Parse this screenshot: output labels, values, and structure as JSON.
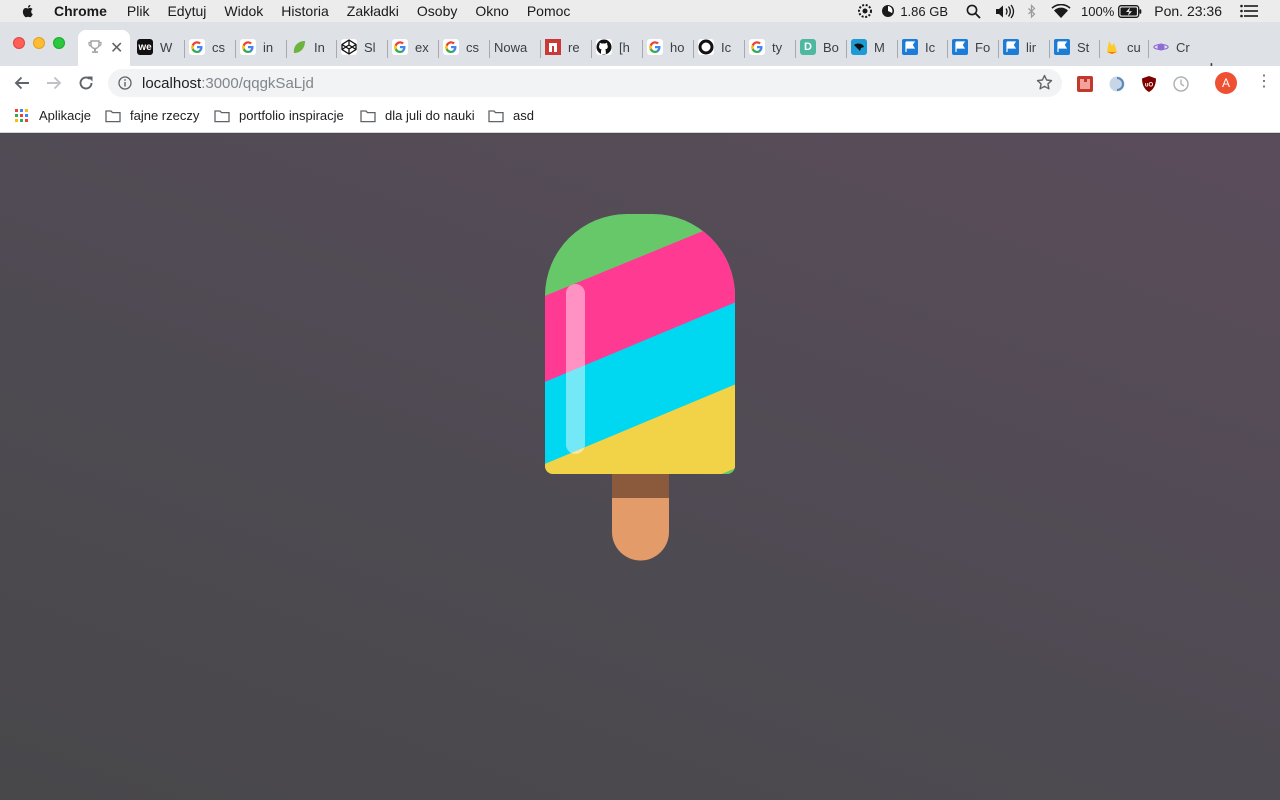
{
  "menubar": {
    "app_name": "Chrome",
    "items": [
      "Plik",
      "Edytuj",
      "Widok",
      "Historia",
      "Zakładki",
      "Osoby",
      "Okno",
      "Pomoc"
    ],
    "ram": "1.86 GB",
    "battery": "100%",
    "clock": "Pon. 23:36"
  },
  "tabs": [
    {
      "title": "W",
      "favicon": "we-icon"
    },
    {
      "title": "cs",
      "favicon": "google-icon"
    },
    {
      "title": "in",
      "favicon": "google-icon"
    },
    {
      "title": "In",
      "favicon": "leaf-icon"
    },
    {
      "title": "Sl",
      "favicon": "codepen-icon"
    },
    {
      "title": "ex",
      "favicon": "google-icon"
    },
    {
      "title": "cs",
      "favicon": "google-icon"
    },
    {
      "title": "Nowa",
      "favicon": ""
    },
    {
      "title": "re",
      "favicon": "npm-icon"
    },
    {
      "title": "[h",
      "favicon": "github-icon"
    },
    {
      "title": "ho",
      "favicon": "google-icon"
    },
    {
      "title": "Ic",
      "favicon": "ring-icon"
    },
    {
      "title": "ty",
      "favicon": "google-icon"
    },
    {
      "title": "Bo",
      "favicon": "d-icon"
    },
    {
      "title": "M",
      "favicon": "bird-icon"
    },
    {
      "title": "Ic",
      "favicon": "flag-icon"
    },
    {
      "title": "Fo",
      "favicon": "flag-icon"
    },
    {
      "title": "lir",
      "favicon": "flag-icon"
    },
    {
      "title": "St",
      "favicon": "flag-icon"
    },
    {
      "title": "cu",
      "favicon": "firebase-icon"
    },
    {
      "title": "Cr",
      "favicon": "planet-icon"
    }
  ],
  "address": {
    "host": "localhost",
    "path": ":3000/qqgkSaLjd"
  },
  "bookmarks": [
    {
      "label": "Aplikacje",
      "icon": "apps-grid-icon"
    },
    {
      "label": "fajne rzeczy",
      "icon": "folder-icon"
    },
    {
      "label": "portfolio inspiracje",
      "icon": "folder-icon"
    },
    {
      "label": "dla juli do nauki",
      "icon": "folder-icon"
    },
    {
      "label": "asd",
      "icon": "folder-icon"
    }
  ],
  "profile": {
    "initial": "A"
  },
  "colors": {
    "page_bg": "#4a474e",
    "stripe_green": "#67c869",
    "stripe_pink": "#ff3a93",
    "stripe_cyan": "#00d8f2",
    "stripe_yellow": "#f2d246",
    "stick_dark": "#8b5a3c",
    "stick_light": "#e39c69"
  }
}
